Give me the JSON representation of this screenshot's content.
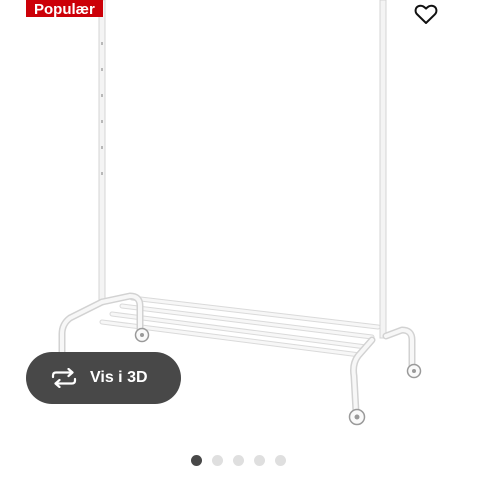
{
  "badge": {
    "label": "Populær"
  },
  "favorite": {
    "icon": "heart-icon"
  },
  "view3d": {
    "label": "Vis i 3D",
    "icon": "rotate-3d-icon"
  },
  "carousel": {
    "total": 5,
    "active": 1
  }
}
